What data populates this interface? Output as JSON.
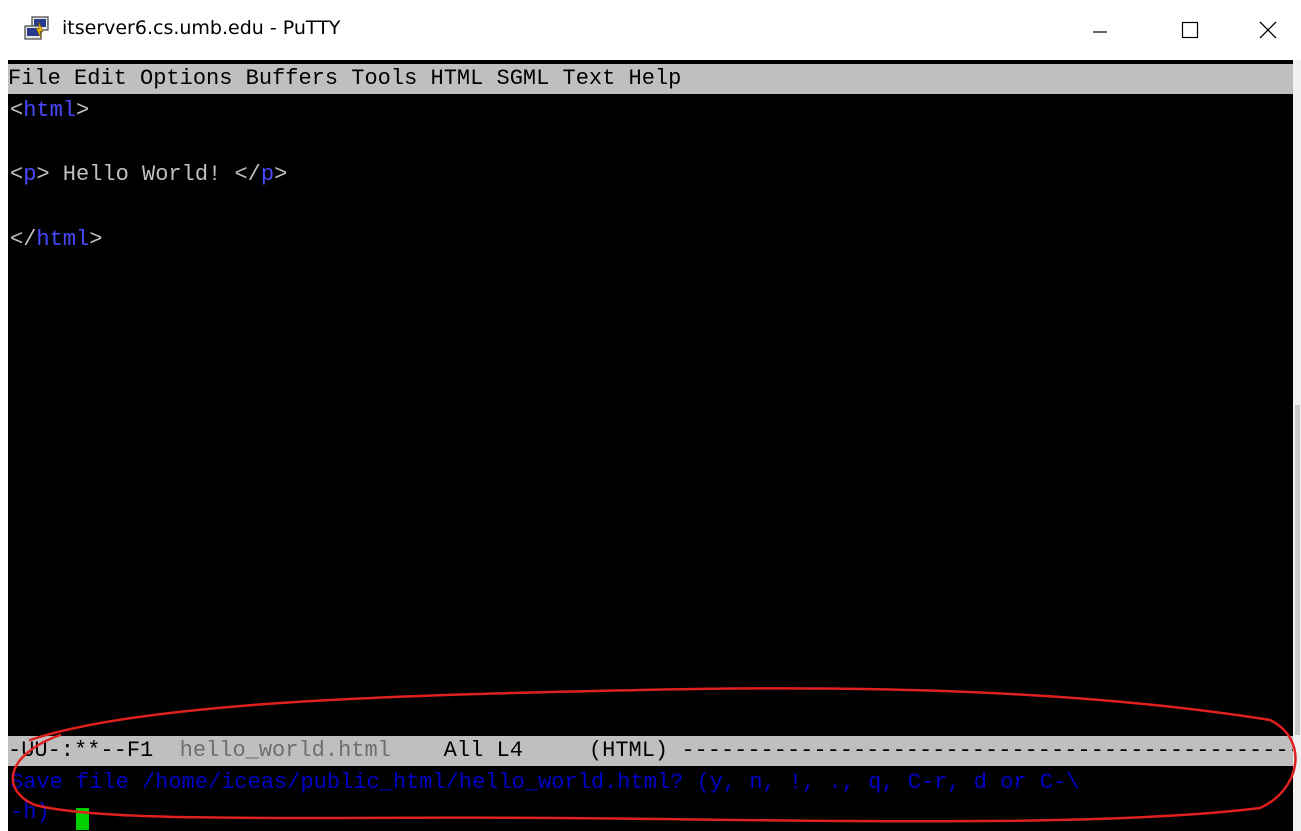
{
  "window": {
    "title": "itserver6.cs.umb.edu - PuTTY",
    "icon": "putty-icon"
  },
  "controls": {
    "minimize_icon": "minimize-icon",
    "maximize_icon": "maximize-icon",
    "close_icon": "close-icon"
  },
  "menubar": {
    "items": [
      "File",
      "Edit",
      "Options",
      "Buffers",
      "Tools",
      "HTML",
      "SGML",
      "Text",
      "Help"
    ]
  },
  "buffer": {
    "line1": {
      "open": "<",
      "tag": "html",
      "close": ">"
    },
    "line2": {
      "open1": "<",
      "tag1": "p",
      "close1": ">",
      "text": " Hello World! ",
      "open2": "</",
      "tag2": "p",
      "close2": ">"
    },
    "line3": {
      "open": "</",
      "tag": "html",
      "close": ">"
    }
  },
  "modeline": {
    "status": "-UU-:**--F1  ",
    "filename": "hello_world.html",
    "position": "    All L4     ",
    "mode": "(HTML) ",
    "fill": "------------------------------------------------"
  },
  "minibuffer": {
    "line1": "Save file /home/iceas/public_html/hello_world.html? (y, n, !, ., q, C-r, d or C-\\",
    "line2": "-h) "
  },
  "colors": {
    "terminal_bg": "#000000",
    "menubar_bg": "#bfbfbf",
    "tag_color": "#4848ff",
    "text_color": "#c0c0c0",
    "prompt_color": "#0000c8",
    "cursor_color": "#00d000",
    "annotation_color": "#e02020"
  }
}
